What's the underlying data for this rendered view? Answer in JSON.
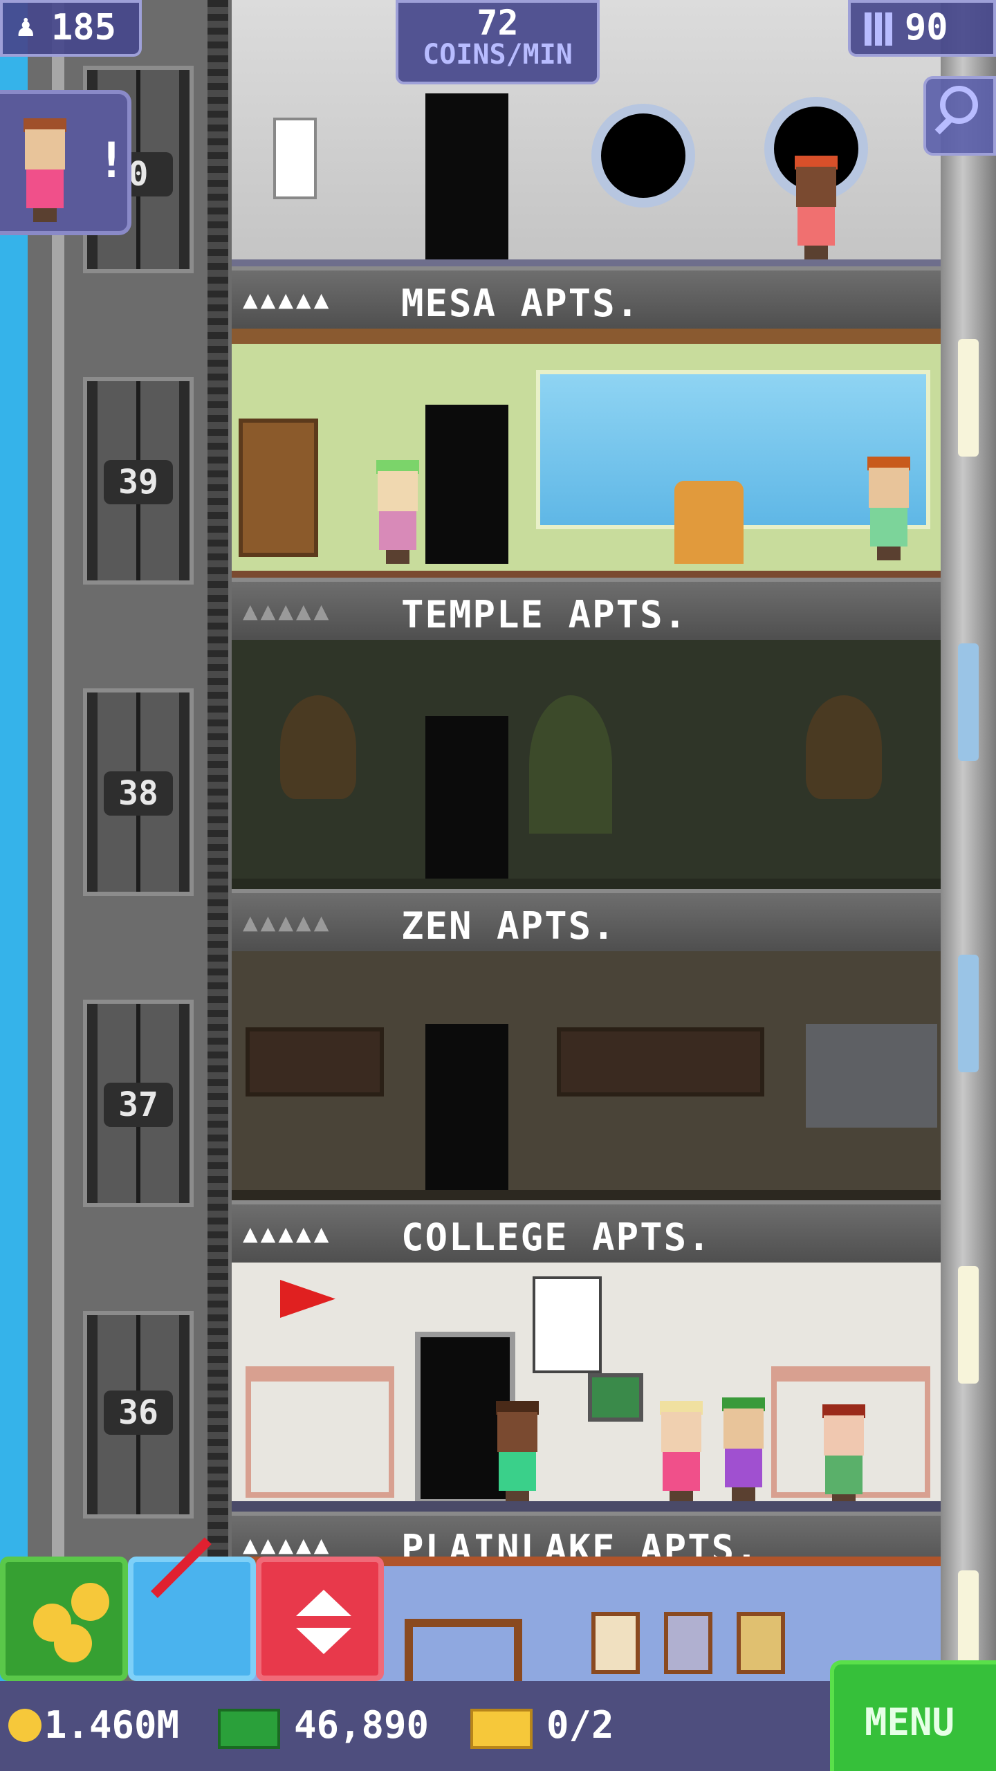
{
  "hud": {
    "population": "185",
    "coins_per_min_value": "72",
    "coins_per_min_label": "COINS/MIN",
    "floors_count": "90"
  },
  "elevator": {
    "floor_numbers": [
      "0",
      "39",
      "38",
      "37",
      "36"
    ]
  },
  "floors": [
    {
      "name": "MESA APTS.",
      "residents": "▲▲▲▲▲"
    },
    {
      "name": "TEMPLE APTS.",
      "residents": "▲▲▲▲▲"
    },
    {
      "name": "ZEN APTS.",
      "residents": "▲▲▲▲▲"
    },
    {
      "name": "COLLEGE APTS.",
      "residents": "▲▲▲▲▲"
    },
    {
      "name": "PLAINLAKE APTS.",
      "residents": "▲▲▲▲▲"
    }
  ],
  "footer": {
    "coins": "1.460M",
    "bux": "46,890",
    "tickets": "0/2",
    "menu_label": "MENU"
  },
  "colors": {
    "accent_green": "#34b53a",
    "accent_blue": "#4ab3ee",
    "accent_red": "#e8394b",
    "hud_purple": "#464890"
  }
}
